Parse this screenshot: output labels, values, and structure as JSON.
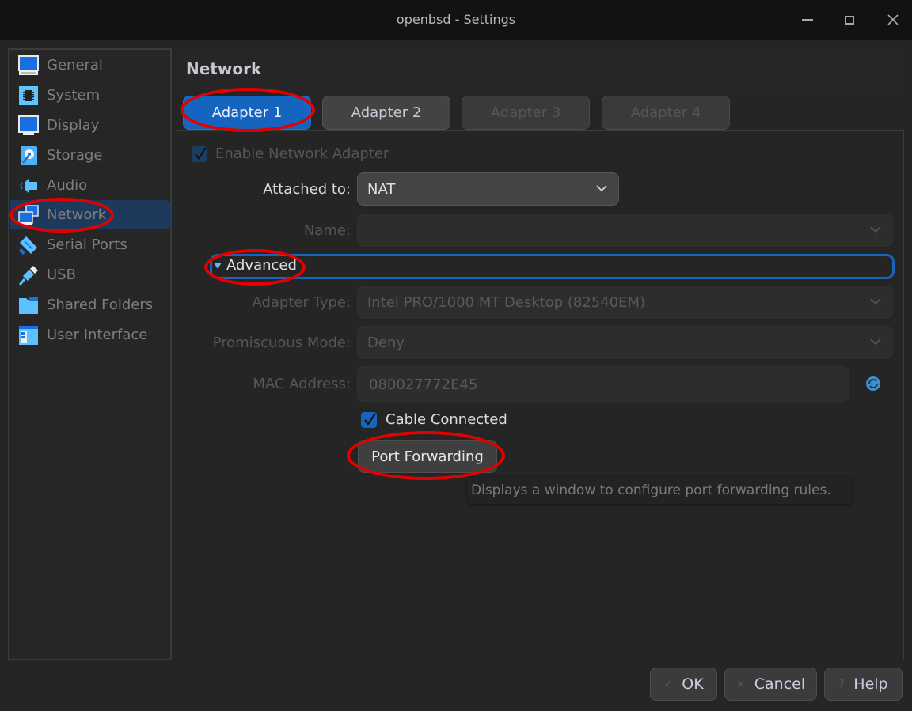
{
  "window": {
    "title": "openbsd - Settings",
    "controls": [
      "minimize",
      "maximize",
      "close"
    ]
  },
  "sidebar": {
    "items": [
      {
        "label": "General",
        "icon": "monitor-icon",
        "selected": false
      },
      {
        "label": "System",
        "icon": "chip-icon",
        "selected": false
      },
      {
        "label": "Display",
        "icon": "display-icon",
        "selected": false
      },
      {
        "label": "Storage",
        "icon": "disk-icon",
        "selected": false
      },
      {
        "label": "Audio",
        "icon": "speaker-icon",
        "selected": false
      },
      {
        "label": "Network",
        "icon": "network-icon",
        "selected": true
      },
      {
        "label": "Serial Ports",
        "icon": "serial-port-icon",
        "selected": false
      },
      {
        "label": "USB",
        "icon": "usb-icon",
        "selected": false
      },
      {
        "label": "Shared Folders",
        "icon": "folder-icon",
        "selected": false
      },
      {
        "label": "User Interface",
        "icon": "window-icon",
        "selected": false
      }
    ]
  },
  "main": {
    "title": "Network",
    "tabs": [
      {
        "label": "Adapter 1",
        "state": "active"
      },
      {
        "label": "Adapter 2",
        "state": "enabled"
      },
      {
        "label": "Adapter 3",
        "state": "disabled"
      },
      {
        "label": "Adapter 4",
        "state": "disabled"
      }
    ],
    "enable_adapter": {
      "label": "Enable Network Adapter",
      "checked": true
    },
    "attached_to": {
      "label": "Attached to:",
      "value": "NAT"
    },
    "name": {
      "label": "Name:",
      "value": ""
    },
    "advanced": {
      "label": "Advanced",
      "expanded": true
    },
    "adapter_type": {
      "label": "Adapter Type:",
      "value": "Intel PRO/1000 MT Desktop (82540EM)"
    },
    "promiscuous_mode": {
      "label": "Promiscuous Mode:",
      "value": "Deny"
    },
    "mac_address": {
      "label": "MAC Address:",
      "value": "080027772E45"
    },
    "cable_connected": {
      "label": "Cable Connected",
      "checked": true
    },
    "port_forwarding": {
      "label": "Port Forwarding"
    },
    "tooltip": "Displays a window to configure port forwarding rules."
  },
  "footer": {
    "ok": {
      "label": "OK",
      "glyph": "✓"
    },
    "cancel": {
      "label": "Cancel",
      "glyph": "×"
    },
    "help": {
      "label": "Help",
      "glyph": "?"
    }
  },
  "colors": {
    "accent": "#1565c0",
    "selection": "#1d3a5c",
    "annotation": "#e50000"
  }
}
